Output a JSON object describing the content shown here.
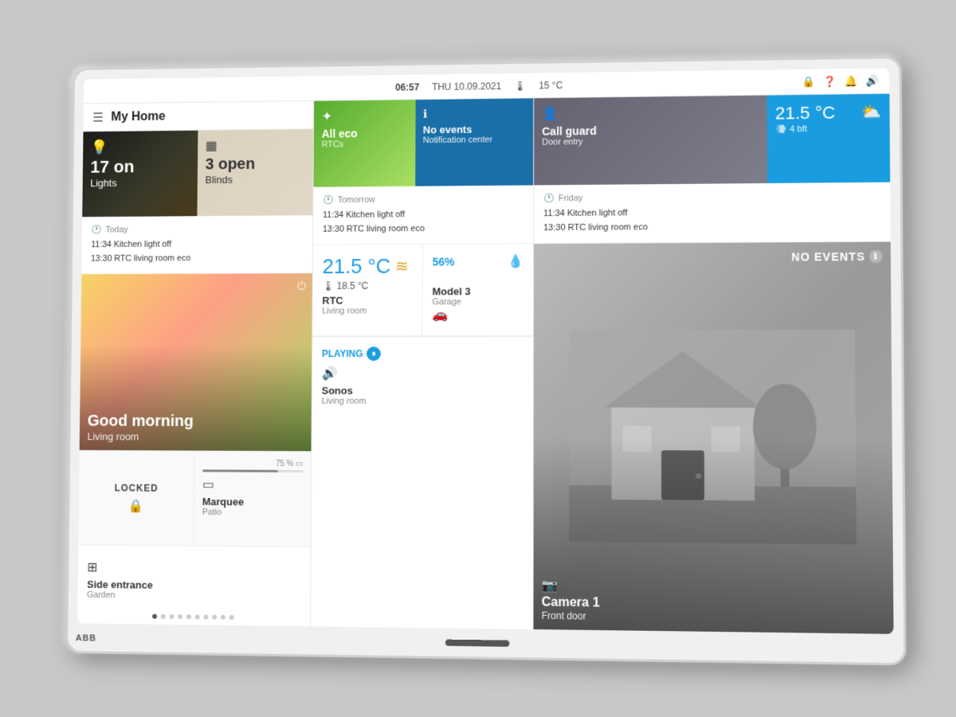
{
  "device": {
    "brand": "ABB"
  },
  "statusbar": {
    "time": "06:57",
    "date": "THU 10.09.2021",
    "temp": "15 °C",
    "icons": [
      "lock",
      "question",
      "bell",
      "volume"
    ]
  },
  "header": {
    "title": "My Home"
  },
  "lights_tile": {
    "count": "17 on",
    "label": "Lights",
    "icon": "💡"
  },
  "blinds_tile": {
    "count": "3 open",
    "label": "Blinds",
    "icon": "▦"
  },
  "schedule_today": {
    "day": "Today",
    "item1": "11:34 Kitchen light off",
    "item2": "13:30 RTC living room eco"
  },
  "schedule_tomorrow": {
    "day": "Tomorrow",
    "item1": "11:34 Kitchen light off",
    "item2": "13:30 RTC living room eco"
  },
  "schedule_friday": {
    "day": "Friday",
    "item1": "11:34 Kitchen light off",
    "item2": "13:30 RTC living room eco"
  },
  "morning_card": {
    "greeting": "Good morning",
    "room": "Living room"
  },
  "locked_tile": {
    "status": "LOCKED",
    "icon": "🔒"
  },
  "marquee_tile": {
    "progress": "75 %",
    "name": "Marquee",
    "location": "Patio",
    "icon": "▭"
  },
  "side_entrance": {
    "name": "Side entrance",
    "location": "Garden",
    "icon": "⊞"
  },
  "eco_tile": {
    "icon": "✦",
    "label": "All eco",
    "sub": "RTCs"
  },
  "notification_tile": {
    "icon": "ℹ",
    "title": "No events",
    "sub": "Notification center"
  },
  "climate_tile": {
    "temp_main": "21.5 °C",
    "heat_icon": "≋",
    "humidity": "56%",
    "temp_sub": "18.5 °C",
    "name": "RTC",
    "location": "Living room"
  },
  "garage_tile": {
    "icon": "🚗",
    "name": "Model 3",
    "location": "Garage"
  },
  "sonos_tile": {
    "playing": "PLAYING",
    "icon": "🔊",
    "name": "Sonos",
    "location": "Living room"
  },
  "callguard_tile": {
    "icon": "👤",
    "title": "Call guard",
    "sub": "Door entry"
  },
  "weather_tile": {
    "temp": "21.5 °C",
    "wind": "4 bft",
    "icon": "⛅"
  },
  "camera_tile": {
    "no_events": "NO EVENTS",
    "icon": "📷",
    "name": "Camera 1",
    "location": "Front door"
  },
  "page_dots": {
    "total": 10,
    "active": 0
  }
}
